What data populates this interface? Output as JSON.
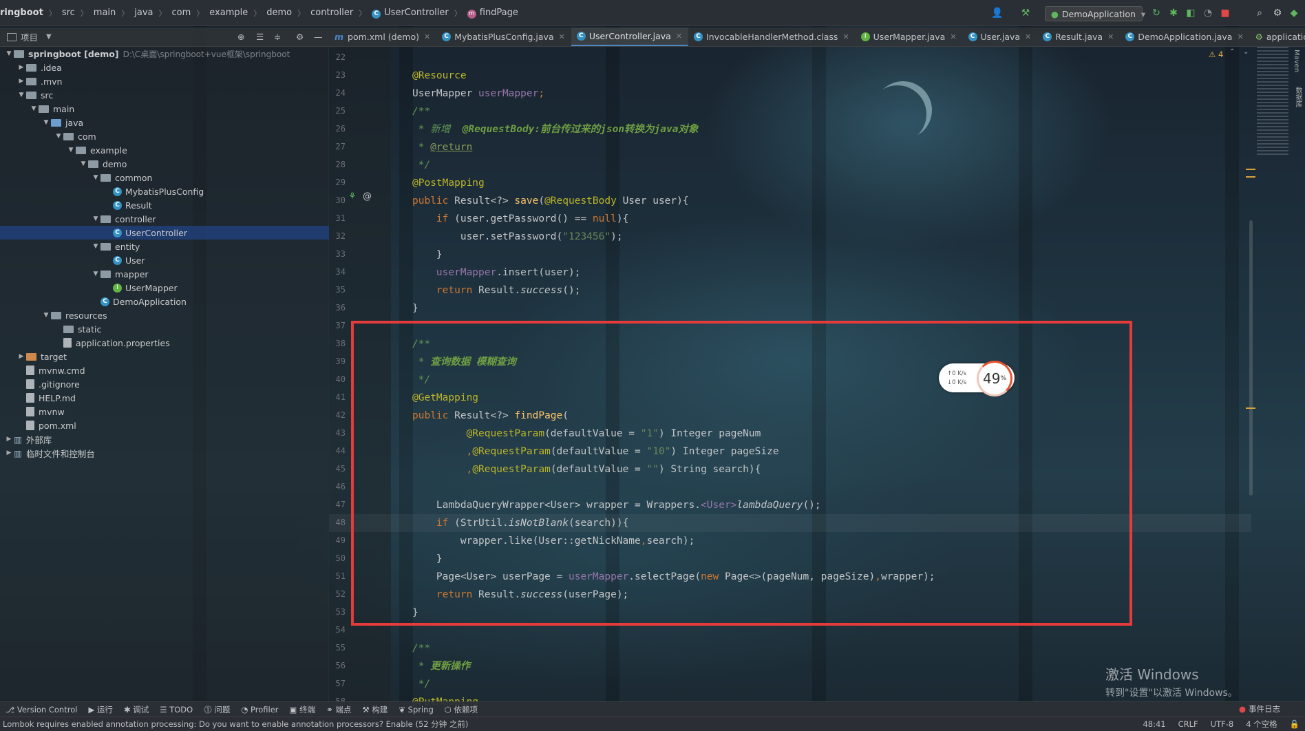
{
  "breadcrumb": [
    "ringboot",
    "src",
    "main",
    "java",
    "com",
    "example",
    "demo",
    "controller",
    "UserController",
    "findPage"
  ],
  "toolbar": {
    "run_config": "DemoApplication"
  },
  "project_panel": {
    "title": "项目"
  },
  "tabs": [
    {
      "label": "pom.xml (demo)",
      "icon": "m"
    },
    {
      "label": "MybatisPlusConfig.java",
      "icon": "c"
    },
    {
      "label": "UserController.java",
      "icon": "c",
      "active": true
    },
    {
      "label": "InvocableHandlerMethod.class",
      "icon": "c"
    },
    {
      "label": "UserMapper.java",
      "icon": "i"
    },
    {
      "label": "User.java",
      "icon": "c"
    },
    {
      "label": "Result.java",
      "icon": "c"
    },
    {
      "label": "DemoApplication.java",
      "icon": "c"
    },
    {
      "label": "applicatic",
      "icon": "p"
    }
  ],
  "tree": [
    {
      "label": "springboot [demo]",
      "hint": "D:\\C桌面\\springboot+vue框架\\springboot",
      "depth": 0,
      "arrow": "down",
      "kind": "gray",
      "bold": true
    },
    {
      "label": ".idea",
      "depth": 1,
      "arrow": "right",
      "kind": "gray"
    },
    {
      "label": ".mvn",
      "depth": 1,
      "arrow": "right",
      "kind": "gray"
    },
    {
      "label": "src",
      "depth": 1,
      "arrow": "down",
      "kind": "gray"
    },
    {
      "label": "main",
      "depth": 2,
      "arrow": "down",
      "kind": "gray"
    },
    {
      "label": "java",
      "depth": 3,
      "arrow": "down",
      "kind": "blue"
    },
    {
      "label": "com",
      "depth": 4,
      "arrow": "down",
      "kind": "gray"
    },
    {
      "label": "example",
      "depth": 5,
      "arrow": "down",
      "kind": "gray"
    },
    {
      "label": "demo",
      "depth": 6,
      "arrow": "down",
      "kind": "gray"
    },
    {
      "label": "common",
      "depth": 7,
      "arrow": "down",
      "kind": "gray"
    },
    {
      "label": "MybatisPlusConfig",
      "depth": 8,
      "kind": "class"
    },
    {
      "label": "Result",
      "depth": 8,
      "kind": "class"
    },
    {
      "label": "controller",
      "depth": 7,
      "arrow": "down",
      "kind": "gray"
    },
    {
      "label": "UserController",
      "depth": 8,
      "kind": "class",
      "selected": true
    },
    {
      "label": "entity",
      "depth": 7,
      "arrow": "down",
      "kind": "gray"
    },
    {
      "label": "User",
      "depth": 8,
      "kind": "class"
    },
    {
      "label": "mapper",
      "depth": 7,
      "arrow": "down",
      "kind": "gray"
    },
    {
      "label": "UserMapper",
      "depth": 8,
      "kind": "intf"
    },
    {
      "label": "DemoApplication",
      "depth": 7,
      "kind": "class"
    },
    {
      "label": "resources",
      "depth": 3,
      "arrow": "down",
      "kind": "gray"
    },
    {
      "label": "static",
      "depth": 4,
      "kind": "gray"
    },
    {
      "label": "application.properties",
      "depth": 4,
      "kind": "file"
    },
    {
      "label": "target",
      "depth": 1,
      "arrow": "right",
      "kind": "orange"
    },
    {
      "label": "mvnw.cmd",
      "depth": 1,
      "kind": "file"
    },
    {
      "label": ".gitignore",
      "depth": 1,
      "kind": "file"
    },
    {
      "label": "HELP.md",
      "depth": 1,
      "kind": "file"
    },
    {
      "label": "mvnw",
      "depth": 1,
      "kind": "file"
    },
    {
      "label": "pom.xml",
      "depth": 1,
      "kind": "file"
    },
    {
      "label": "外部库",
      "depth": 0,
      "arrow": "right",
      "kind": "lib"
    },
    {
      "label": "临时文件和控制台",
      "depth": 0,
      "arrow": "right",
      "kind": "lib"
    }
  ],
  "editor": {
    "first_line": 22,
    "warnings": "⚠ 4",
    "lines": [
      [],
      [
        [
          "an",
          "@Resource"
        ]
      ],
      [
        [
          "",
          "UserMapper "
        ],
        [
          "fd",
          "userMapper"
        ],
        [
          "kw",
          ";"
        ]
      ],
      [
        [
          "cm",
          "/**"
        ]
      ],
      [
        [
          "cm",
          " * 新增  "
        ],
        [
          "cmb",
          "@RequestBody:前台传过来的json转换为java对象"
        ]
      ],
      [
        [
          "cm",
          " * "
        ],
        [
          "tag",
          "@return"
        ]
      ],
      [
        [
          "cm",
          " */"
        ]
      ],
      [
        [
          "an",
          "@PostMapping"
        ]
      ],
      [
        [
          "kw",
          "public "
        ],
        [
          "",
          "Result<?> "
        ],
        [
          "fn",
          "save"
        ],
        [
          "",
          "("
        ],
        [
          "an",
          "@RequestBody "
        ],
        [
          "",
          "User user){"
        ]
      ],
      [
        [
          "",
          "    "
        ],
        [
          "kw",
          "if "
        ],
        [
          "",
          "(user.getPassword() == "
        ],
        [
          "kw",
          "null"
        ],
        [
          "",
          "){"
        ]
      ],
      [
        [
          "",
          "        user.setPassword("
        ],
        [
          "st",
          "\"123456\""
        ],
        [
          "",
          "); "
        ]
      ],
      [
        [
          "",
          "    }"
        ]
      ],
      [
        [
          "",
          "    "
        ],
        [
          "fd",
          "userMapper"
        ],
        [
          "",
          ".insert(user);"
        ]
      ],
      [
        [
          "",
          "    "
        ],
        [
          "kw",
          "return "
        ],
        [
          "",
          "Result."
        ],
        [
          "it",
          "success"
        ],
        [
          "",
          "();"
        ]
      ],
      [
        [
          "",
          "}"
        ]
      ],
      [],
      [
        [
          "cm",
          "/**"
        ]
      ],
      [
        [
          "cm",
          " * "
        ],
        [
          "cmb",
          "查询数据 模糊查询"
        ]
      ],
      [
        [
          "cm",
          " */"
        ]
      ],
      [
        [
          "an",
          "@GetMapping"
        ]
      ],
      [
        [
          "kw",
          "public "
        ],
        [
          "",
          "Result<?> "
        ],
        [
          "fn",
          "findPage"
        ],
        [
          "",
          "("
        ]
      ],
      [
        [
          "",
          "         "
        ],
        [
          "an",
          "@RequestParam"
        ],
        [
          "",
          "(defaultValue = "
        ],
        [
          "st",
          "\"1\""
        ],
        [
          "",
          ") Integer pageNum"
        ]
      ],
      [
        [
          "",
          "         "
        ],
        [
          "kw",
          ","
        ],
        [
          "an",
          "@RequestParam"
        ],
        [
          "",
          "(defaultValue = "
        ],
        [
          "st",
          "\"10\""
        ],
        [
          "",
          ") Integer pageSize"
        ]
      ],
      [
        [
          "",
          "         "
        ],
        [
          "kw",
          ","
        ],
        [
          "an",
          "@RequestParam"
        ],
        [
          "",
          "(defaultValue = "
        ],
        [
          "st",
          "\"\""
        ],
        [
          "",
          ") String search){"
        ]
      ],
      [],
      [
        [
          "",
          "    LambdaQueryWrapper<User> wrapper = Wrappers."
        ],
        [
          "fd",
          "<User>"
        ],
        [
          "it",
          "lambdaQuery"
        ],
        [
          "",
          "();"
        ]
      ],
      [
        [
          "",
          "    "
        ],
        [
          "kw",
          "if "
        ],
        [
          "",
          "(StrUtil."
        ],
        [
          "it",
          "isNotBlank"
        ],
        [
          "",
          "(search)){"
        ]
      ],
      [
        [
          "",
          "        wrapper.like(User::getNickName"
        ],
        [
          "kw",
          ","
        ],
        [
          "",
          "search);"
        ]
      ],
      [
        [
          "",
          "    }"
        ]
      ],
      [
        [
          "",
          "    Page<User> userPage = "
        ],
        [
          "fd",
          "userMapper"
        ],
        [
          "",
          ".selectPage("
        ],
        [
          "kw",
          "new "
        ],
        [
          "",
          "Page<>(pageNum, pageSize)"
        ],
        [
          "kw",
          ","
        ],
        [
          "",
          "wrapper);"
        ]
      ],
      [
        [
          "",
          "    "
        ],
        [
          "kw",
          "return "
        ],
        [
          "",
          "Result."
        ],
        [
          "it",
          "success"
        ],
        [
          "",
          "(userPage);"
        ]
      ],
      [
        [
          "",
          "}"
        ]
      ],
      [],
      [
        [
          "cm",
          "/**"
        ]
      ],
      [
        [
          "cm",
          " * "
        ],
        [
          "cmb",
          "更新操作"
        ]
      ],
      [
        [
          "cm",
          " */"
        ]
      ],
      [
        [
          "an",
          "@PutMapping"
        ]
      ]
    ]
  },
  "network_widget": {
    "up": "↑0 K/s",
    "down": "↓0 K/s",
    "percent": "49",
    "unit": "%"
  },
  "watermark": {
    "line1": "激活 Windows",
    "line2": "转到\"设置\"以激活 Windows。"
  },
  "toolwindows": [
    "Version Control",
    "运行",
    "调试",
    "TODO",
    "问题",
    "Profiler",
    "终端",
    "端点",
    "构建",
    "Spring",
    "依赖项"
  ],
  "status": {
    "message": "Lombok requires enabled annotation processing: Do you want to enable annotation processors? Enable (52 分钟 之前)",
    "position": "48:41",
    "line_sep": "CRLF",
    "encoding": "UTF-8",
    "indent": "4 个空格",
    "event_log": "事件日志"
  },
  "colors": {
    "highlight_box": "#e63b3b",
    "accent": "#4a88c7",
    "selection": "#214283"
  }
}
